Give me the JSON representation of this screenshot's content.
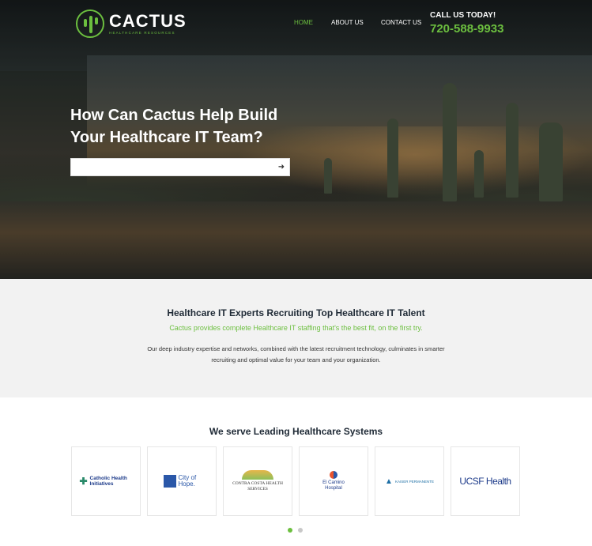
{
  "brand": {
    "name": "CACTUS",
    "tagline": "HEALTHCARE RESOURCES",
    "accent_color": "#6cbf3f"
  },
  "nav": {
    "items": [
      {
        "label": "HOME",
        "active": true
      },
      {
        "label": "ABOUT US",
        "active": false
      },
      {
        "label": "CONTACT US",
        "active": false
      }
    ]
  },
  "contact": {
    "label": "CALL US TODAY!",
    "phone": "720-588-9933"
  },
  "hero": {
    "title": "How Can Cactus Help Build Your Healthcare IT Team?",
    "search_value": "",
    "search_icon": "arrow-right-icon"
  },
  "intro": {
    "heading": "Healthcare IT Experts Recruiting Top Healthcare IT Talent",
    "tagline": "Cactus provides complete Healthcare IT staffing that's the best fit, on the first try.",
    "body": "Our deep industry expertise and networks, combined with the latest recruitment technology, culminates in smarter recruiting and optimal value for your team and your organization."
  },
  "partners": {
    "heading": "We serve Leading Healthcare Systems",
    "logos": [
      {
        "name": "Catholic Health Initiatives"
      },
      {
        "name": "City of Hope."
      },
      {
        "name": "CONTRA COSTA HEALTH SERVICES"
      },
      {
        "name": "El Camino Hospital"
      },
      {
        "name": "KAISER PERMANENTE"
      },
      {
        "name": "UCSF Health"
      }
    ],
    "carousel": {
      "pages": 2,
      "current": 1
    }
  }
}
